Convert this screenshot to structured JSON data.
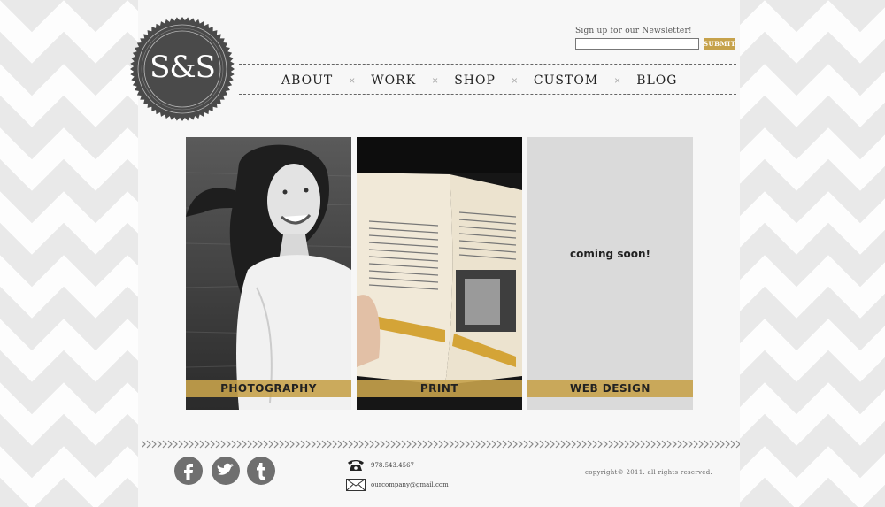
{
  "logo": {
    "text": "S&S"
  },
  "newsletter": {
    "label": "Sign up for our Newsletter!",
    "input_value": "",
    "submit_label": "SUBMIT"
  },
  "nav": {
    "items": [
      {
        "label": "ABOUT"
      },
      {
        "label": "WORK"
      },
      {
        "label": "SHOP"
      },
      {
        "label": "CUSTOM"
      },
      {
        "label": "BLOG"
      }
    ],
    "separator": "×"
  },
  "tiles": [
    {
      "caption": "PHOTOGRAPHY"
    },
    {
      "caption": "PRINT"
    },
    {
      "caption": "WEB DESIGN",
      "placeholder": "coming soon!"
    }
  ],
  "footer": {
    "social": [
      "facebook-icon",
      "twitter-icon",
      "tumblr-icon"
    ],
    "phone": "978.543.4567",
    "email": "ourcompany@gmail.com",
    "copyright": "copyright© 2011. all rights reserved."
  },
  "colors": {
    "accent": "#c6a24b",
    "seal": "#4a4a4a",
    "social": "#6f6f6f",
    "web_tile": "#dadada"
  }
}
